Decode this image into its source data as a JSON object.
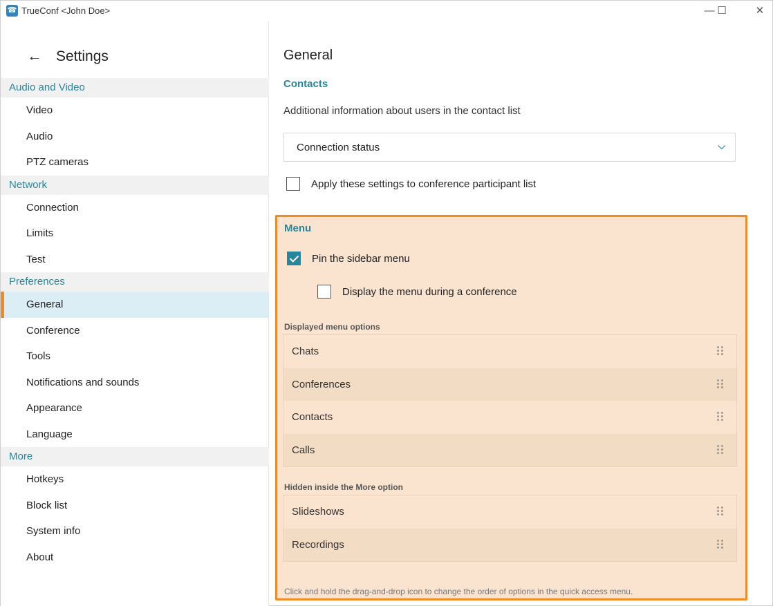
{
  "window": {
    "title": "TrueConf <John Doe>",
    "controls": {
      "minimize": "—",
      "maximize": "☐",
      "close": "✕"
    }
  },
  "sidebar": {
    "back_icon": "arrow-left-icon",
    "title": "Settings",
    "sections": [
      {
        "label": "Audio and Video",
        "items": [
          "Video",
          "Audio",
          "PTZ cameras"
        ]
      },
      {
        "label": "Network",
        "items": [
          "Connection",
          "Limits",
          "Test"
        ]
      },
      {
        "label": "Preferences",
        "items": [
          "General",
          "Conference",
          "Tools",
          "Notifications and sounds",
          "Appearance",
          "Language"
        ]
      },
      {
        "label": "More",
        "items": [
          "Hotkeys",
          "Block list",
          "System info",
          "About"
        ]
      }
    ],
    "active_item": "General",
    "accent_color": "#f08a24"
  },
  "main": {
    "title": "General",
    "contacts": {
      "section_title": "Contacts",
      "description": "Additional information about users in the contact list",
      "select_value": "Connection status",
      "apply_label": "Apply these settings to conference participant list",
      "apply_checked": false
    },
    "menu": {
      "section_title": "Menu",
      "pin_label": "Pin the sidebar menu",
      "pin_checked": true,
      "display_label": "Display the menu during a conference",
      "display_checked": false,
      "displayed_title": "Displayed menu options",
      "displayed_options": [
        "Chats",
        "Conferences",
        "Contacts",
        "Calls"
      ],
      "hidden_title": "Hidden inside the More option",
      "hidden_options": [
        "Slideshows",
        "Recordings"
      ],
      "hint": "Click and hold the drag-and-drop icon to change the order of options in the quick access menu.",
      "highlight_color": "#f08a24",
      "highlight_fill": "#fbe4cf"
    }
  },
  "colors": {
    "accent": "#27869b",
    "section_bg": "#f1f1f1",
    "active_item_bg": "#dbeef5"
  }
}
